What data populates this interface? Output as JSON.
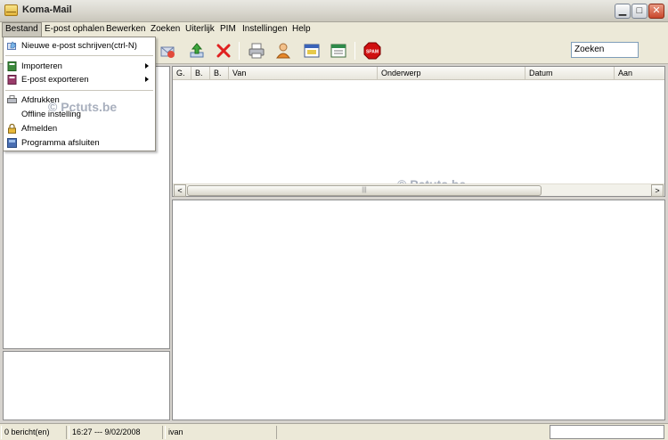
{
  "window": {
    "title": "Koma-Mail",
    "min_glyph": "▁",
    "max_glyph": "□",
    "close_glyph": "✕"
  },
  "menubar": {
    "items": [
      "Bestand",
      "E-post ophalen",
      "Bewerken",
      "Zoeken",
      "Uiterlijk",
      "PIM",
      "Instellingen",
      "Help"
    ]
  },
  "bestand_menu": {
    "items": [
      {
        "label": "Nieuwe e-post schrijven(ctrl-N)",
        "icon": "compose-icon"
      },
      {
        "label": "Importeren",
        "icon": "import-icon",
        "submenu": true
      },
      {
        "label": "E-post exporteren",
        "icon": "export-icon",
        "submenu": true
      },
      {
        "label": "Afdrukken",
        "icon": "printer-icon"
      },
      {
        "label": "Offline instelling",
        "icon": ""
      },
      {
        "label": "Afmelden",
        "icon": "lock-icon"
      },
      {
        "label": "Programma afsluiten",
        "icon": "exit-icon"
      }
    ]
  },
  "toolbar": {
    "search_value": "Zoeken",
    "spam_label": "SPAM"
  },
  "message_list": {
    "columns": [
      "G.",
      "B.",
      "B.",
      "Van",
      "Onderwerp",
      "Datum",
      "Aan"
    ]
  },
  "scrollbar": {
    "left_glyph": "<",
    "right_glyph": ">",
    "grip_glyph": "|||"
  },
  "watermark": "© Pctuts.be",
  "statusbar": {
    "message_count": "0 bericht(en)",
    "datetime": "16:27 --- 9/02/2008",
    "user": "ivan"
  },
  "colors": {
    "accent_red": "#e02020",
    "spam_red": "#d01010"
  }
}
